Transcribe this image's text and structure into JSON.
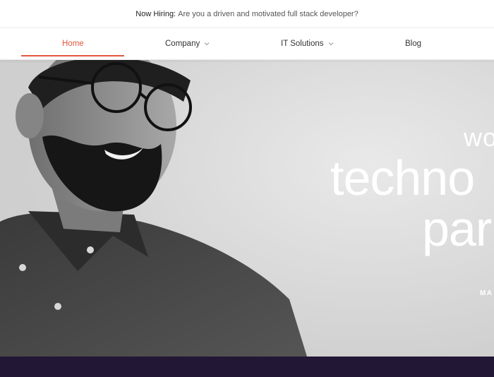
{
  "announcement": {
    "label": "Now Hiring:",
    "message": "Are you a driven and motivated full stack developer?"
  },
  "nav": {
    "items": [
      {
        "label": "Home",
        "active": true,
        "has_dropdown": false
      },
      {
        "label": "Company",
        "active": false,
        "has_dropdown": true
      },
      {
        "label": "IT Solutions",
        "active": false,
        "has_dropdown": true
      },
      {
        "label": "Blog",
        "active": false,
        "has_dropdown": false
      }
    ],
    "dropdown_icon": "chevron-down-icon"
  },
  "hero": {
    "line_small": "wo",
    "line_large_1": "techno",
    "line_large_2": "par",
    "cta_fragment": "MA"
  },
  "colors": {
    "accent": "#e3573f",
    "footer_band": "#221734",
    "hero_text": "#ffffff"
  }
}
